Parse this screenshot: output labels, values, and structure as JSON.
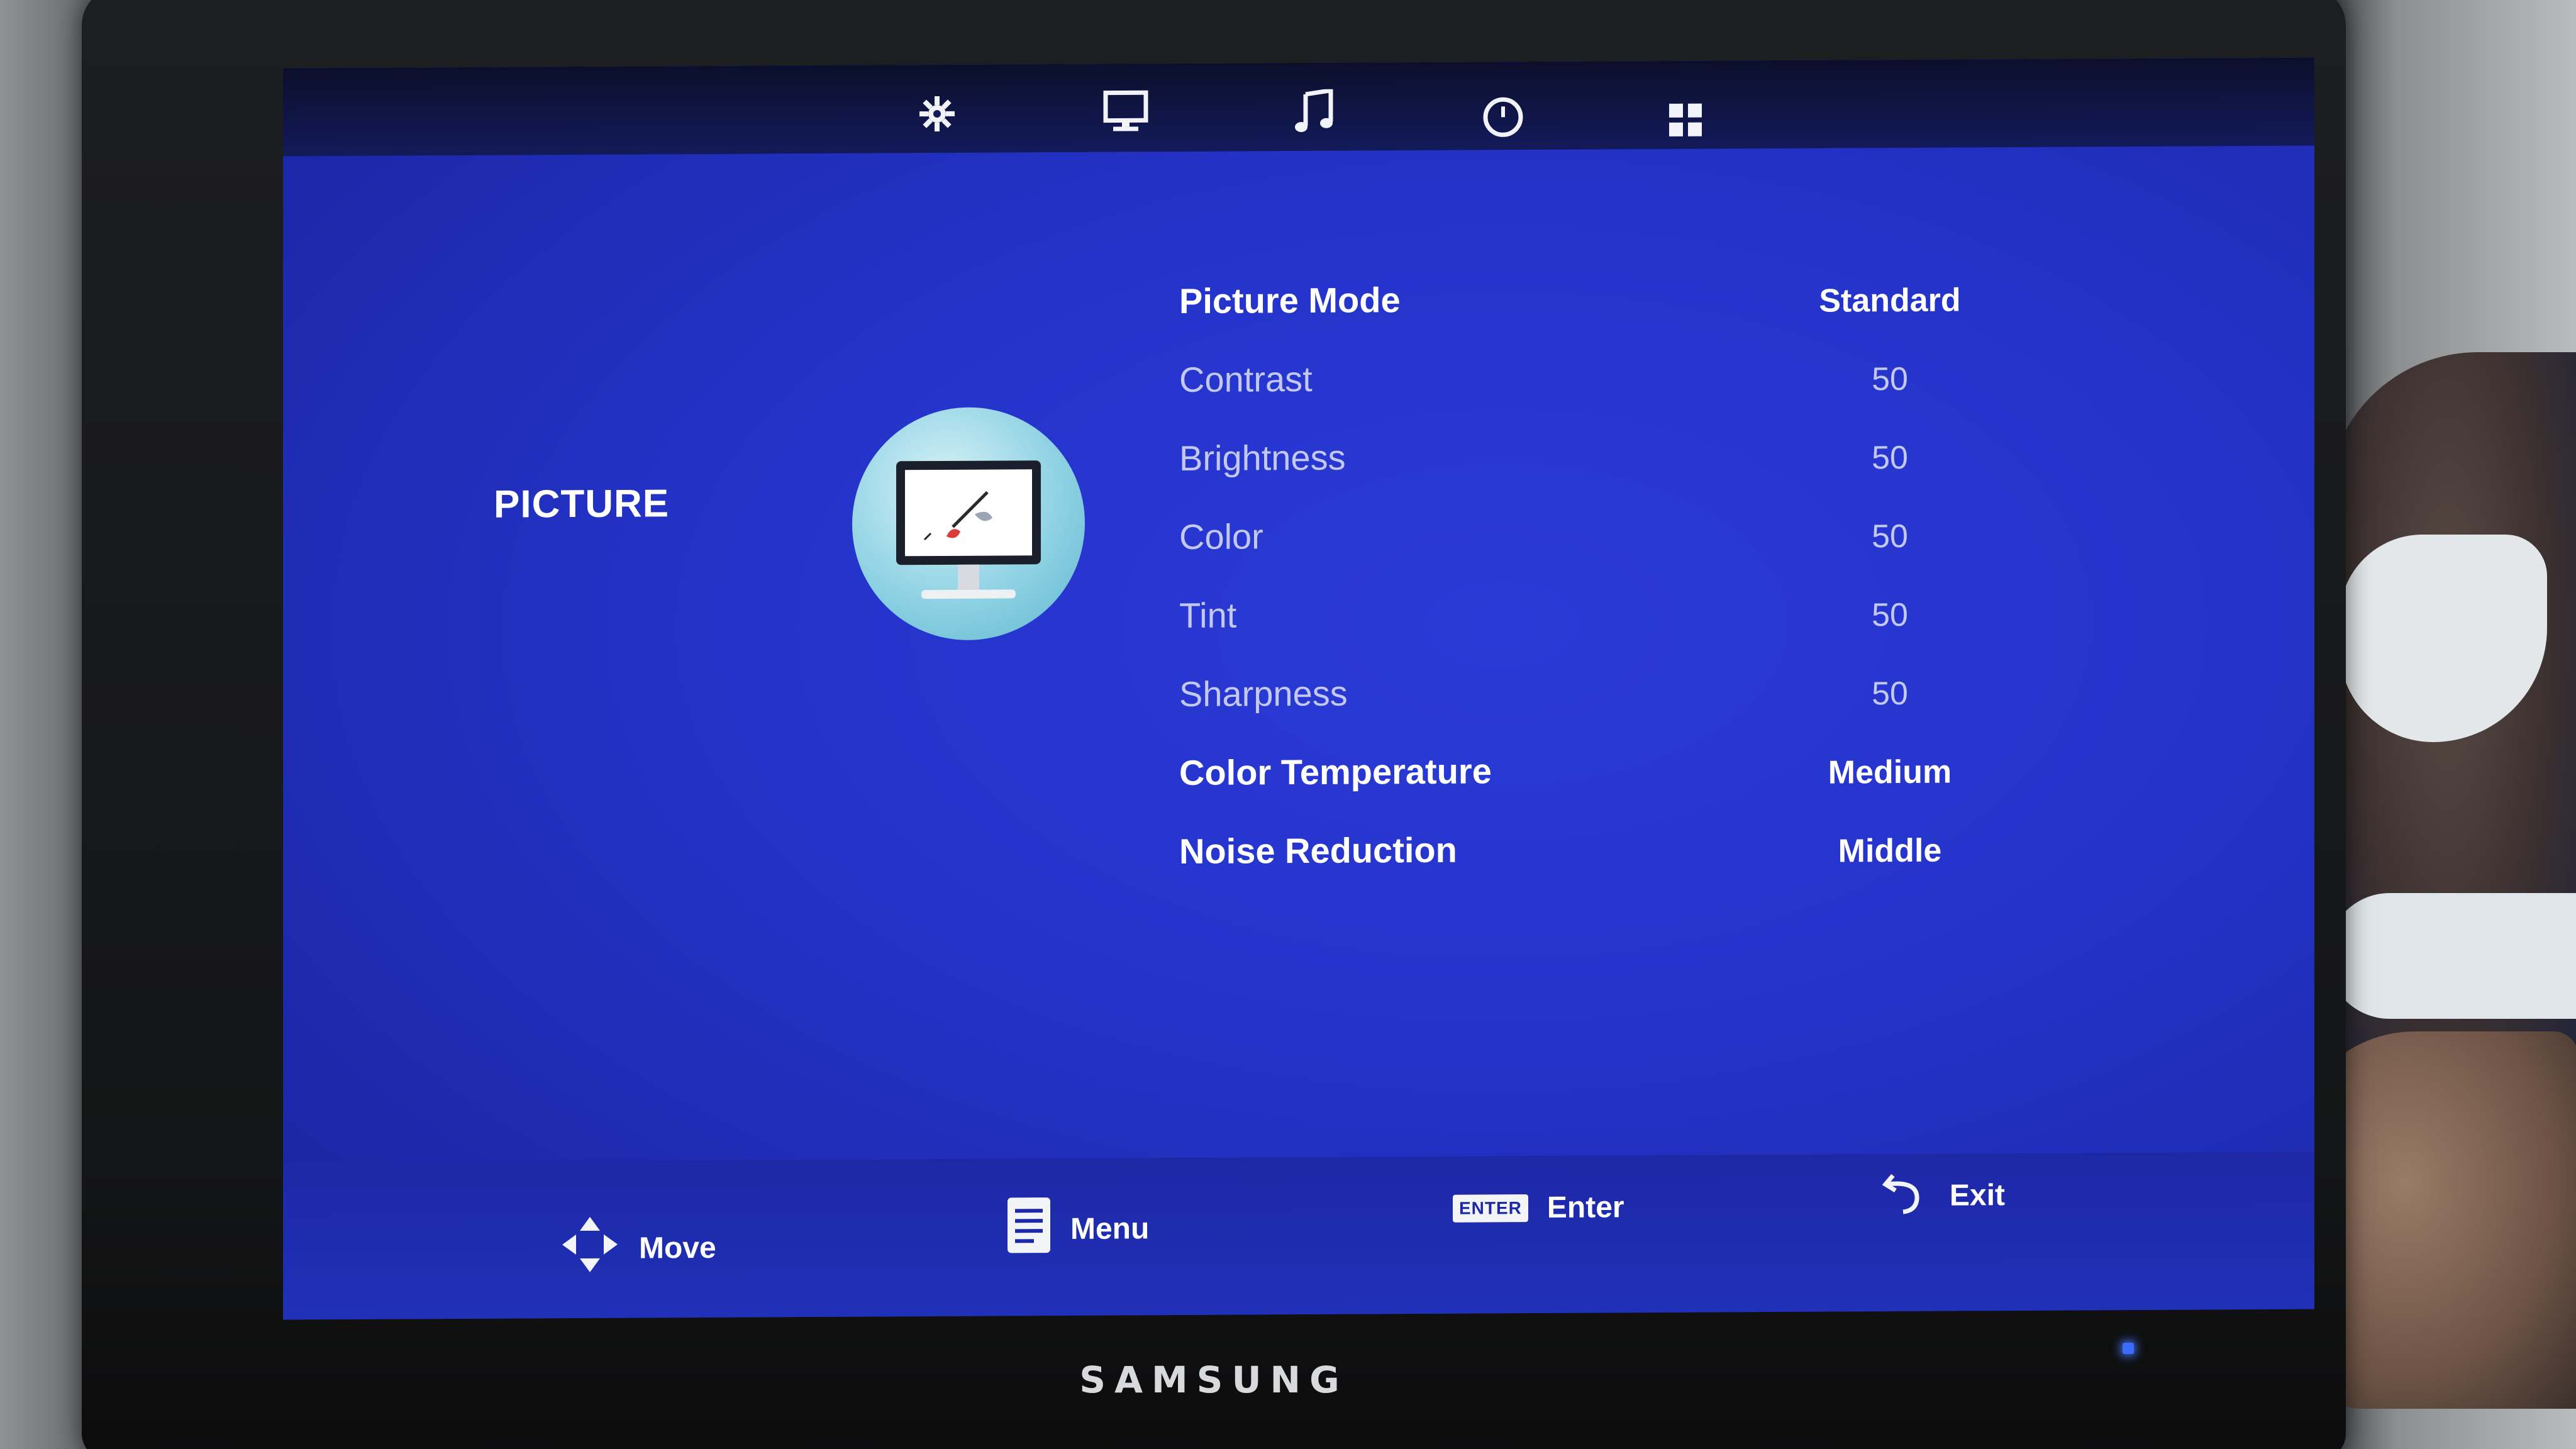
{
  "device": {
    "brand": "SAMSUNG"
  },
  "top_nav": {
    "icons": [
      "settings-icon",
      "picture-monitor-icon",
      "music-note-icon",
      "clock-icon",
      "apps-grid-icon"
    ],
    "active_index": 1
  },
  "section": {
    "title": "PICTURE",
    "icon": "picture-monitor-icon"
  },
  "menu": {
    "items": [
      {
        "label": "Picture Mode",
        "value": "Standard",
        "enabled": true
      },
      {
        "label": "Contrast",
        "value": "50",
        "enabled": false
      },
      {
        "label": "Brightness",
        "value": "50",
        "enabled": false
      },
      {
        "label": "Color",
        "value": "50",
        "enabled": false
      },
      {
        "label": "Tint",
        "value": "50",
        "enabled": false
      },
      {
        "label": "Sharpness",
        "value": "50",
        "enabled": false
      },
      {
        "label": "Color Temperature",
        "value": "Medium",
        "enabled": true
      },
      {
        "label": "Noise Reduction",
        "value": "Middle",
        "enabled": true
      }
    ]
  },
  "hints": {
    "move": "Move",
    "menu": "Menu",
    "enter_key": "ENTER",
    "enter": "Enter",
    "exit": "Exit"
  },
  "colors": {
    "screen_blue": "#2433c9",
    "text_active": "#ffffff",
    "text_dim": "#c3c8ee"
  }
}
